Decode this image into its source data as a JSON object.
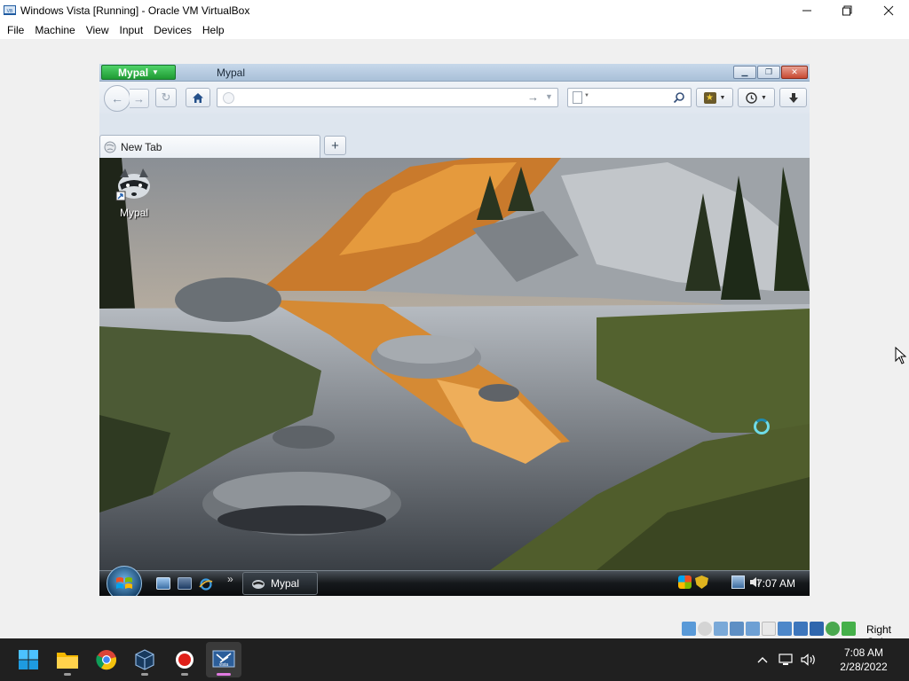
{
  "vbox": {
    "title": "Windows Vista [Running] - Oracle VM VirtualBox",
    "menu": [
      "File",
      "Machine",
      "View",
      "Input",
      "Devices",
      "Help"
    ],
    "host_key": "Right Ctrl"
  },
  "mypal": {
    "app_button": "Mypal",
    "window_title": "Mypal",
    "url_value": "",
    "search_value": "",
    "tabs": [
      {
        "label": "New Tab",
        "active": true
      }
    ]
  },
  "vista": {
    "desktop_icons": [
      {
        "label": "Mypal",
        "icon": "raccoon-icon"
      }
    ],
    "taskbar_tasks": [
      {
        "label": "Mypal",
        "icon": "raccoon-icon"
      }
    ],
    "clock": "7:07 AM",
    "wallpaper": "mountain-lake-reflection"
  },
  "host_taskbar": {
    "apps": [
      "start-icon",
      "file-explorer-icon",
      "chrome-icon",
      "virtualbox-icon",
      "screen-recorder-icon",
      "windows-vista-vm-icon"
    ],
    "active_app": "windows-vista-vm-icon",
    "clock_time": "7:08 AM",
    "clock_date": "2/28/2022"
  },
  "colors": {
    "mypal_green": "#2bb03f",
    "vista_cursor": "#6fdce8",
    "host_taskbar": "#202020"
  }
}
